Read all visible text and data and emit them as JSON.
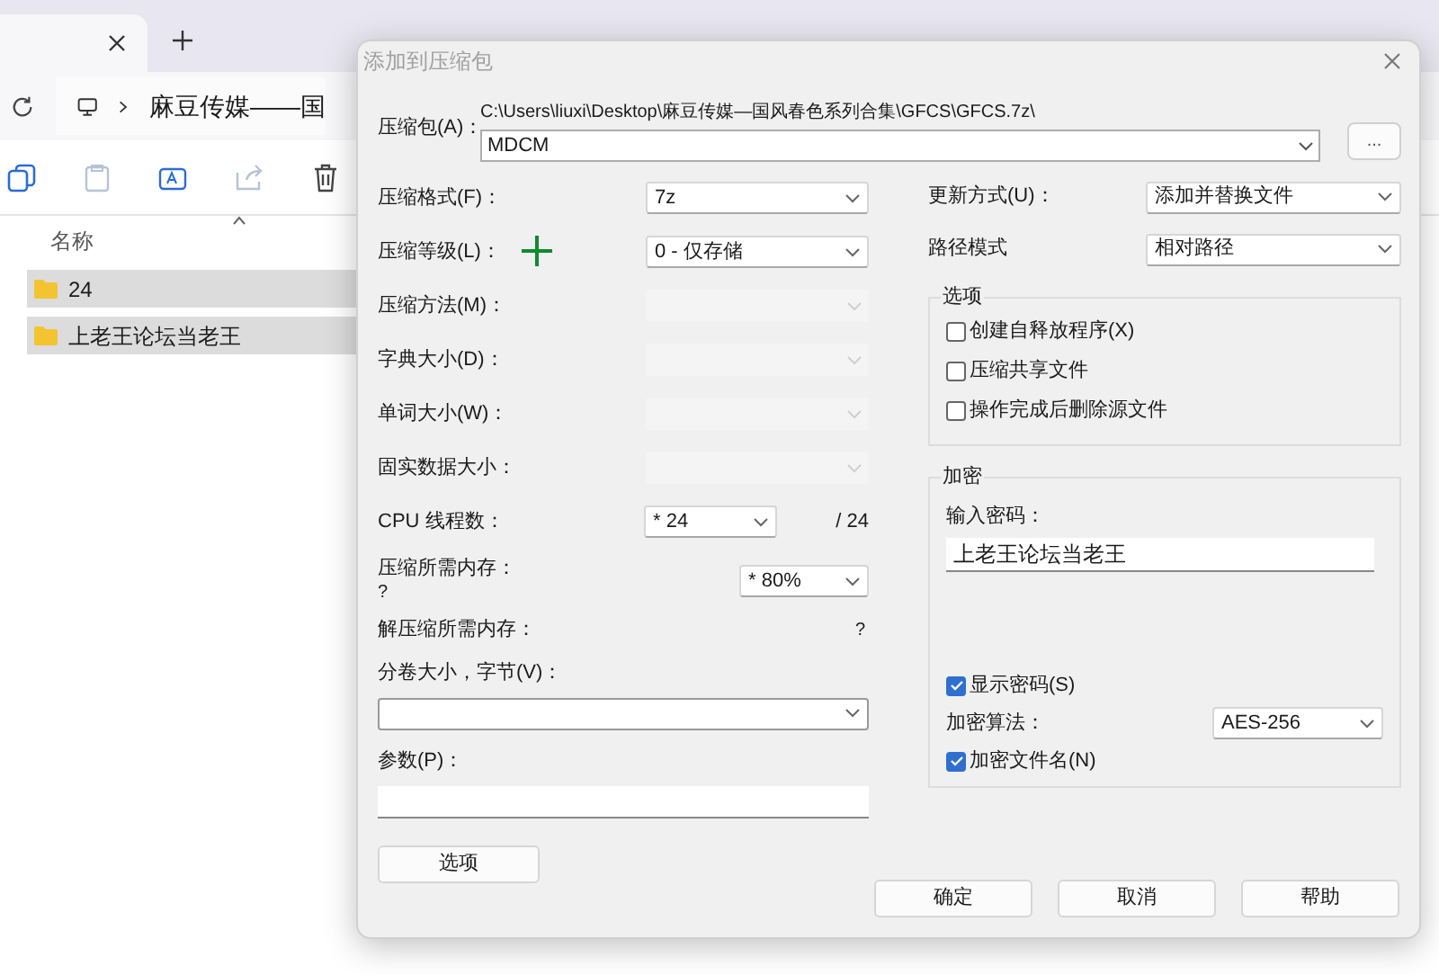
{
  "explorer": {
    "breadcrumb": "麻豆传媒——国",
    "column_header": "名称",
    "items": [
      {
        "name": "24",
        "selected": true
      },
      {
        "name": "上老王论坛当老王",
        "selected": true
      }
    ]
  },
  "dialog": {
    "title": "添加到压缩包",
    "archive_label": "压缩包(A)：",
    "archive_path": "C:\\Users\\liuxi\\Desktop\\麻豆传媒—国风春色系列合集\\GFCS\\GFCS.7z\\",
    "archive_name": "MDCM",
    "browse_button": "...",
    "left_rows": [
      {
        "kind": "select",
        "label": "压缩格式(F)：",
        "value": "7z",
        "disabled": false
      },
      {
        "kind": "select",
        "label": "压缩等级(L)：",
        "value": "0 - 仅存储",
        "disabled": false
      },
      {
        "kind": "select",
        "label": "压缩方法(M)：",
        "disabled": true
      },
      {
        "kind": "select",
        "label": "字典大小(D)：",
        "disabled": true
      },
      {
        "kind": "select",
        "label": "单词大小(W)：",
        "disabled": true
      },
      {
        "kind": "select",
        "label": "固实数据大小：",
        "disabled": true
      },
      {
        "kind": "cpu",
        "label": "CPU 线程数：",
        "value": "* 24",
        "suffix": "/ 24",
        "disabled": false
      },
      {
        "kind": "memory",
        "label": "压缩所需内存：",
        "note": "?",
        "value": "* 80%",
        "disabled": false
      },
      {
        "kind": "info",
        "label": "解压缩所需内存：",
        "value": "?"
      },
      {
        "kind": "stacked_select",
        "label": "分卷大小，字节(V)：",
        "disabled": false
      },
      {
        "kind": "stacked_input",
        "label": "参数(P)："
      }
    ],
    "options_button": "选项",
    "right_rows": [
      {
        "label": "更新方式(U)：",
        "value": "添加并替换文件"
      },
      {
        "label": "路径模式",
        "value": "相对路径"
      }
    ],
    "options_group": {
      "legend": "选项",
      "checkboxes": [
        {
          "label": "创建自释放程序(X)",
          "checked": false
        },
        {
          "label": "压缩共享文件",
          "checked": false
        },
        {
          "label": "操作完成后删除源文件",
          "checked": false
        }
      ]
    },
    "encryption_group": {
      "legend": "加密",
      "password_label": "输入密码：",
      "password": "上老王论坛当老王",
      "show_password": {
        "label": "显示密码(S)",
        "checked": true
      },
      "method_label": "加密算法：",
      "method": "AES-256",
      "encrypt_names": {
        "label": "加密文件名(N)",
        "checked": true
      }
    },
    "buttons": [
      "确定",
      "取消",
      "帮助"
    ]
  }
}
